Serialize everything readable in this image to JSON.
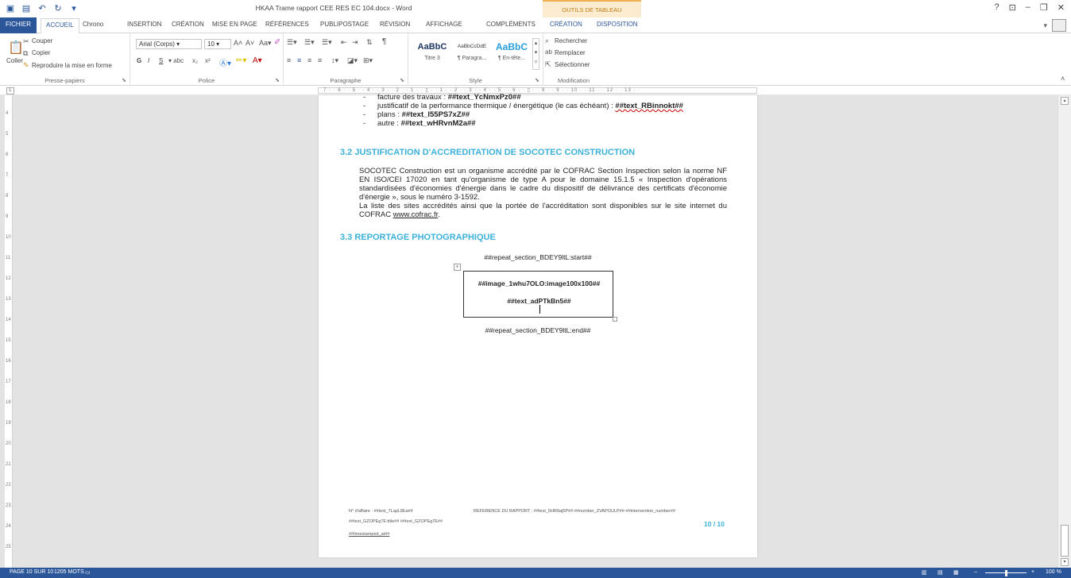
{
  "titlebar": {
    "document_title": "HKAA Trame rapport CEE RES EC 104.docx - Word",
    "table_tools_label": "OUTILS DE TABLEAU",
    "help": "?",
    "ribbon_display": "⊡",
    "minimize": "–",
    "restore": "❐",
    "close": "✕"
  },
  "tabs": {
    "file": "FICHIER",
    "home": "ACCUEIL",
    "chrono": "Chrono",
    "insert": "INSERTION",
    "design": "CRÉATION",
    "layout": "MISE EN PAGE",
    "references": "RÉFÉRENCES",
    "mailings": "PUBLIPOSTAGE",
    "review": "RÉVISION",
    "view": "AFFICHAGE",
    "addins": "COMPLÉMENTS",
    "table_design": "CRÉATION",
    "table_layout": "DISPOSITION"
  },
  "ribbon": {
    "clipboard": {
      "paste": "Coller",
      "cut": "Couper",
      "copy": "Copier",
      "format_painter": "Reproduire la mise en forme",
      "label": "Presse-papiers"
    },
    "font": {
      "font_name": "Arial (Corps)",
      "font_size": "10",
      "bold": "G",
      "italic": "I",
      "underline": "S",
      "label": "Police"
    },
    "paragraph": {
      "label": "Paragraphe"
    },
    "styles": {
      "items": [
        {
          "sample": "AaBbC",
          "name": "Titre 3"
        },
        {
          "sample": "AaBbCcDdE",
          "name": "¶ Paragra..."
        },
        {
          "sample": "AaBbC",
          "name": "¶ En-tête..."
        }
      ],
      "label": "Style"
    },
    "editing": {
      "find": "Rechercher",
      "replace": "Remplacer",
      "select": "Sélectionner",
      "label": "Modification"
    }
  },
  "ruler": {
    "marks": "7 · · 6 · · 5 · · 4 · · 3 · · 2 · · 1 · · ▯ · · 1 · · 2 · · 3 · · 4 · · 5 · · 6 · · ▯ · · 8 · · 9 · · 10 · · 11 · · 12 · · 13 · ·"
  },
  "vertical_ruler": [
    "4",
    "5",
    "6",
    "7",
    "8",
    "9",
    "10",
    "11",
    "12",
    "13",
    "14",
    "15",
    "16",
    "17",
    "18",
    "19",
    "20",
    "21",
    "22",
    "23",
    "24",
    "25"
  ],
  "document": {
    "bullets": [
      {
        "text": "facture des travaux : ",
        "bold": "##text_YcNmxPz0##"
      },
      {
        "text": "justificatif de la performance thermique / énergétique (le cas échéant) : ",
        "bold": "##text_RBinnokt##"
      },
      {
        "text": "plans : ",
        "bold": "##text_l55PS7xZ##"
      },
      {
        "text": "autre : ",
        "bold": "##text_wHRvnM2a##"
      }
    ],
    "heading_32": "3.2 JUSTIFICATION D'ACCREDITATION DE SOCOTEC CONSTRUCTION",
    "para_32a": "SOCOTEC Construction est un organisme accrédité par le COFRAC Section Inspection selon la norme NF EN ISO/CEI 17020 en tant qu'organisme de type A pour le domaine 15.1.5 « Inspection d'opérations standardisées d'économies d'énergie dans le cadre du dispositif de délivrance des certificats d'économie d'énergie », sous le numéro 3-1592.",
    "para_32b": "La liste des sites accrédités ainsi que la portée de l'accréditation sont disponibles sur le site internet du COFRAC ",
    "link": "www.cofrac.fr",
    "link_suffix": ".",
    "heading_33": "3.3 REPORTAGE PHOTOGRAPHIQUE",
    "repeat_start": "##repeat_section_BDEY9ltL:start##",
    "image_tag": "##image_1whu7OLO:image100x100##",
    "text_tag": "##text_adPTkBn5##",
    "repeat_end": "##repeat_section_BDEY9ltL:end##",
    "footer_affaire": "N° d'affaire : ##text_7LapL8Ea##",
    "footer_ref": "REFERENCE DU RAPPORT : ##text_5HR0aj5P##-##number_ZVAPOULP##-##intervention_number##",
    "footer_title": "##text_GZOPEg7E:title## ##text_GZOPEg7E##",
    "footer_timestamp": "##timestamped_at##",
    "page_number": "10 / 10"
  },
  "statusbar": {
    "page": "PAGE 10 SUR 10",
    "words": "1205 MOTS",
    "zoom": "100 %"
  },
  "colors": {
    "word_blue": "#2b579a",
    "heading_cyan": "#3cb1d9",
    "table_tools_orange": "#c37a16"
  }
}
